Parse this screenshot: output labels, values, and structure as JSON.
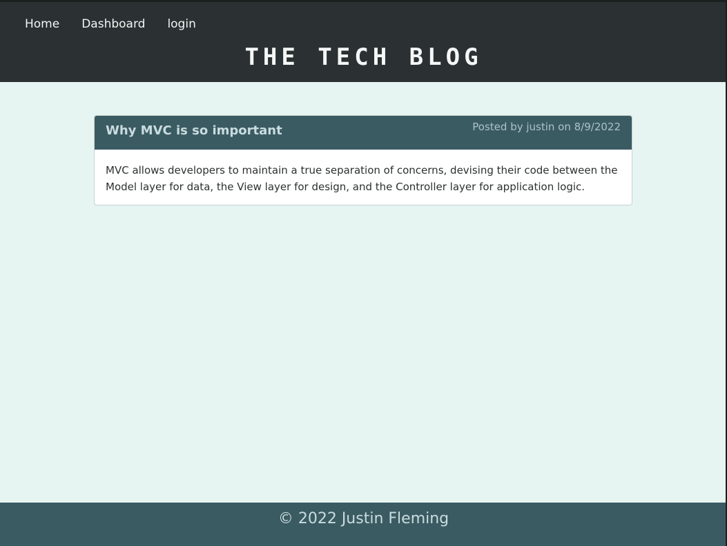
{
  "nav": {
    "items": [
      {
        "label": "Home"
      },
      {
        "label": "Dashboard"
      },
      {
        "label": "login"
      }
    ]
  },
  "site": {
    "title": "The Tech Blog"
  },
  "post": {
    "title": "Why MVC is so important",
    "meta": "Posted by justin on 8/9/2022",
    "body": "MVC allows developers to maintain a true separation of concerns, devising their code between the Model layer for data, the View layer for design, and the Controller layer for application logic."
  },
  "footer": {
    "text": "© 2022 Justin Fleming"
  },
  "colors": {
    "header_bg": "#2b3132",
    "page_bg": "#e6f5f1",
    "accent": "#3b5b63"
  }
}
